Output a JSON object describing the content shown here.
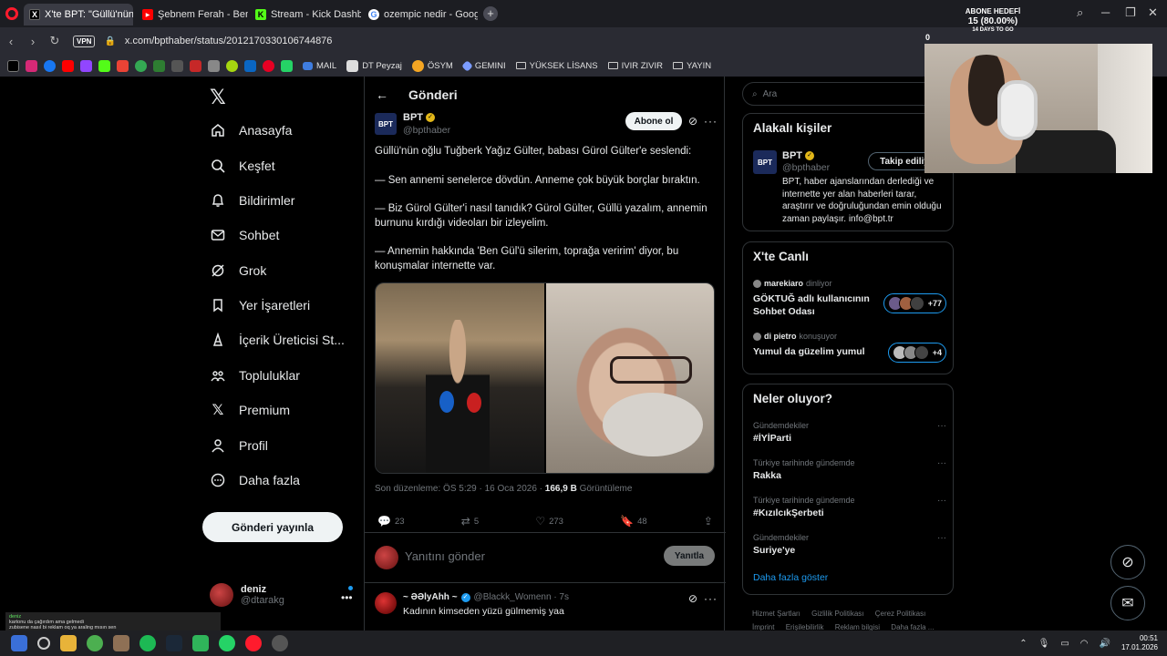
{
  "browser": {
    "tabs": [
      {
        "label": "X'te BPT: \"Güllü'nün oğlu",
        "color": "#000000",
        "glyph": "X",
        "active": true
      },
      {
        "label": "Şebnem Ferah - Ben Şarkı",
        "color": "#ff0000",
        "glyph": "▶",
        "active": false
      },
      {
        "label": "Stream - Kick Dashboard",
        "color": "#53fc18",
        "glyph": "K",
        "active": false
      },
      {
        "label": "ozempic nedir - Google'da",
        "color": "#ffffff",
        "glyph": "G",
        "active": false
      }
    ],
    "vpn_label": "VPN",
    "url": "x.com/bpthaber/status/2012170330106744876",
    "bookmarks": [
      {
        "label": "MAIL",
        "icon": "mail-icon"
      },
      {
        "label": "DT Peyzaj",
        "icon": "site-icon"
      },
      {
        "label": "ÖSYM",
        "icon": "osym-icon"
      },
      {
        "label": "GEMINI",
        "icon": "gemini-icon"
      },
      {
        "label": "YÜKSEK LİSANS",
        "icon": "folder-icon"
      },
      {
        "label": "IVIR ZIVIR",
        "icon": "folder-icon"
      },
      {
        "label": "YAYIN",
        "icon": "folder-icon"
      }
    ]
  },
  "stream_overlay": {
    "goal_title": "ABONE HEDEFİ",
    "goal_value": "15 (80.00%)",
    "goal_sub": "14 DAYS TO GO",
    "count": "0",
    "chat_user": "deniz",
    "chat_line1": "kartonu da çağırdım ama gelmedi",
    "chat_line2": "zubisene nasıl bi reklam oq ya araling mısın sen"
  },
  "nav": {
    "items": [
      {
        "label": "Anasayfa",
        "icon": "home-icon"
      },
      {
        "label": "Keşfet",
        "icon": "search-icon"
      },
      {
        "label": "Bildirimler",
        "icon": "bell-icon"
      },
      {
        "label": "Sohbet",
        "icon": "mail-icon"
      },
      {
        "label": "Grok",
        "icon": "grok-icon"
      },
      {
        "label": "Yer İşaretleri",
        "icon": "bookmark-icon"
      },
      {
        "label": "İçerik Üreticisi St...",
        "icon": "creator-icon"
      },
      {
        "label": "Topluluklar",
        "icon": "communities-icon"
      },
      {
        "label": "Premium",
        "icon": "x-premium-icon"
      },
      {
        "label": "Profil",
        "icon": "profile-icon"
      },
      {
        "label": "Daha fazla",
        "icon": "more-circle-icon"
      }
    ],
    "post_button": "Gönderi yayınla",
    "me_name": "deniz",
    "me_handle": "@dtarakg"
  },
  "post": {
    "header_title": "Gönderi",
    "author_name": "BPT",
    "author_avatar": "BPT",
    "author_handle": "@bpthaber",
    "follow_label": "Abone ol",
    "paragraphs": [
      "Güllü'nün oğlu Tuğberk Yağız Gülter, babası Gürol Gülter'e seslendi:",
      "— Sen annemi senelerce dövdün. Anneme çok büyük borçlar bıraktın.",
      "— Biz Gürol Gülter'i nasıl tanıdık? Gürol Gülter, Güllü yazalım, annemin burnunu kırdığı videoları bir izleyelim.",
      "— Annemin hakkında 'Ben Gül'ü silerim, toprağa veririm' diyor, bu konuşmalar internette var."
    ],
    "meta_prefix": "Son düzenleme: ÖS 5:29 · 16 Oca 2026 · ",
    "views_count": "166,9 B",
    "views_label": " Görüntüleme",
    "stats": {
      "replies": "23",
      "reposts": "5",
      "likes": "273",
      "bookmarks": "48"
    },
    "reply_placeholder": "Yanıtını gönder",
    "reply_button": "Yanıtla"
  },
  "reply": {
    "name": "~ ƏƏlyAhh ~",
    "handle": "@Blackk_Womenn · 7s",
    "text": "Kadının kimseden yüzü gülmemiş yaa"
  },
  "sidebar": {
    "search_placeholder": "Ara",
    "related_title": "Alakalı kişiler",
    "related": {
      "name": "BPT",
      "handle": "@bpthaber",
      "follow": "Takip ediliyor",
      "bio": "BPT, haber ajanslarından derlediği ve internette yer alan haberleri tarar, araştırır ve doğruluğundan emin olduğu zaman paylaşır. info@bpt.tr"
    },
    "live_title": "X'te Canlı",
    "live": [
      {
        "host": "marekiaro",
        "status": "dinliyor",
        "title": "GÖKTUĞ adlı kullanıcının Sohbet Odası",
        "count": "+77"
      },
      {
        "host": "di pietro",
        "status": "konuşuyor",
        "title": "Yumul da güzelim yumul",
        "count": "+4"
      }
    ],
    "trends_title": "Neler oluyor?",
    "trends": [
      {
        "category": "Gündemdekiler",
        "name": "#İYİParti"
      },
      {
        "category": "Türkiye tarihinde gündemde",
        "name": "Rakka"
      },
      {
        "category": "Türkiye tarihinde gündemde",
        "name": "#KızılcıkŞerbeti"
      },
      {
        "category": "Gündemdekiler",
        "name": "Suriye'ye"
      }
    ],
    "show_more": "Daha fazla göster",
    "footer": [
      "Hizmet Şartları",
      "Gizlilik Politikası",
      "Çerez Politikası",
      "İmprint",
      "Erişilebilirlik",
      "Reklam bilgisi",
      "Daha fazla ..."
    ]
  },
  "taskbar": {
    "time": "00:51",
    "date": "17.01.2026"
  },
  "colors": {
    "accent": "#1d9bf0",
    "background": "#000000",
    "verified_gold": "#e2b719"
  }
}
